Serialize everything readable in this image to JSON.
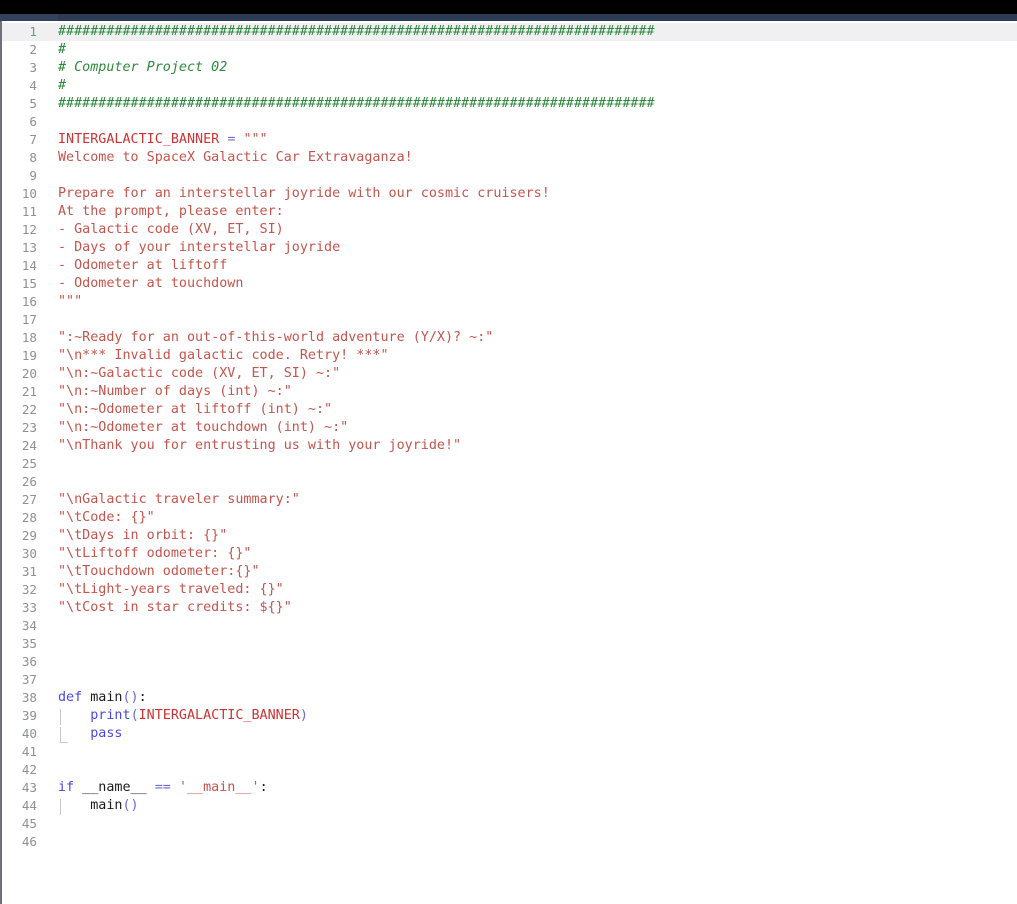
{
  "window": {
    "titlebar_color": "#000000",
    "tabstrip_color": "#2b3a55",
    "active_tab_color": "#33415c"
  },
  "editor": {
    "language": "python",
    "active_line": 1,
    "background": "#ffffff",
    "active_line_background": "#f0f0f2",
    "gutter_color": "#8e9095",
    "active_gutter_color": "#6aa06a",
    "total_lines": 46,
    "colors": {
      "comment": "#2f8a3f",
      "string": "#c4554d",
      "identifier": "#cc3333",
      "keyword": "#4a4ae0",
      "operator": "#6a6ad6",
      "plain": "#1b1b1b"
    },
    "lines": [
      {
        "n": 1,
        "text": "##########################################################################"
      },
      {
        "n": 2,
        "text": "#"
      },
      {
        "n": 3,
        "text": "# Computer Project 02"
      },
      {
        "n": 4,
        "text": "#"
      },
      {
        "n": 5,
        "text": "##########################################################################"
      },
      {
        "n": 6,
        "text": ""
      },
      {
        "n": 7,
        "text": "INTERGALACTIC_BANNER = \"\"\""
      },
      {
        "n": 8,
        "text": "Welcome to SpaceX Galactic Car Extravaganza!"
      },
      {
        "n": 9,
        "text": ""
      },
      {
        "n": 10,
        "text": "Prepare for an interstellar joyride with our cosmic cruisers!"
      },
      {
        "n": 11,
        "text": "At the prompt, please enter:"
      },
      {
        "n": 12,
        "text": "- Galactic code (XV, ET, SI)"
      },
      {
        "n": 13,
        "text": "- Days of your interstellar joyride"
      },
      {
        "n": 14,
        "text": "- Odometer at liftoff"
      },
      {
        "n": 15,
        "text": "- Odometer at touchdown"
      },
      {
        "n": 16,
        "text": "\"\"\""
      },
      {
        "n": 17,
        "text": ""
      },
      {
        "n": 18,
        "text": "\":~Ready for an out-of-this-world adventure (Y/X)? ~:\""
      },
      {
        "n": 19,
        "text": "\"\\n*** Invalid galactic code. Retry! ***\""
      },
      {
        "n": 20,
        "text": "\"\\n:~Galactic code (XV, ET, SI) ~:\""
      },
      {
        "n": 21,
        "text": "\"\\n:~Number of days (int) ~:\""
      },
      {
        "n": 22,
        "text": "\"\\n:~Odometer at liftoff (int) ~:\""
      },
      {
        "n": 23,
        "text": "\"\\n:~Odometer at touchdown (int) ~:\""
      },
      {
        "n": 24,
        "text": "\"\\nThank you for entrusting us with your joyride!\""
      },
      {
        "n": 25,
        "text": ""
      },
      {
        "n": 26,
        "text": ""
      },
      {
        "n": 27,
        "text": "\"\\nGalactic traveler summary:\""
      },
      {
        "n": 28,
        "text": "\"\\tCode: {}\""
      },
      {
        "n": 29,
        "text": "\"\\tDays in orbit: {}\""
      },
      {
        "n": 30,
        "text": "\"\\tLiftoff odometer: {}\""
      },
      {
        "n": 31,
        "text": "\"\\tTouchdown odometer:{}\""
      },
      {
        "n": 32,
        "text": "\"\\tLight-years traveled: {}\""
      },
      {
        "n": 33,
        "text": "\"\\tCost in star credits: ${}\""
      },
      {
        "n": 34,
        "text": ""
      },
      {
        "n": 35,
        "text": ""
      },
      {
        "n": 36,
        "text": ""
      },
      {
        "n": 37,
        "text": ""
      },
      {
        "n": 38,
        "text": "def main():"
      },
      {
        "n": 39,
        "text": "    print(INTERGALACTIC_BANNER)"
      },
      {
        "n": 40,
        "text": "    pass"
      },
      {
        "n": 41,
        "text": ""
      },
      {
        "n": 42,
        "text": ""
      },
      {
        "n": 43,
        "text": "if __name__ == '__main__':"
      },
      {
        "n": 44,
        "text": "    main()"
      },
      {
        "n": 45,
        "text": ""
      },
      {
        "n": 46,
        "text": ""
      }
    ],
    "tokens": {
      "1": [
        [
          "comment",
          "##########################################################################"
        ]
      ],
      "2": [
        [
          "comment",
          "#"
        ]
      ],
      "3": [
        [
          "comment",
          "# Computer Project 02"
        ]
      ],
      "4": [
        [
          "comment",
          "#"
        ]
      ],
      "5": [
        [
          "comment",
          "##########################################################################"
        ]
      ],
      "7": [
        [
          "identifier",
          "INTERGALACTIC_BANNER"
        ],
        [
          "plain",
          " "
        ],
        [
          "operator",
          "="
        ],
        [
          "plain",
          " "
        ],
        [
          "string",
          "\"\"\""
        ]
      ],
      "8": [
        [
          "string",
          "Welcome to SpaceX Galactic Car Extravaganza!"
        ]
      ],
      "10": [
        [
          "string",
          "Prepare for an interstellar joyride with our cosmic cruisers!"
        ]
      ],
      "11": [
        [
          "string",
          "At the prompt, please enter:"
        ]
      ],
      "12": [
        [
          "string",
          "- Galactic code (XV, ET, SI)"
        ]
      ],
      "13": [
        [
          "string",
          "- Days of your interstellar joyride"
        ]
      ],
      "14": [
        [
          "string",
          "- Odometer at liftoff"
        ]
      ],
      "15": [
        [
          "string",
          "- Odometer at touchdown"
        ]
      ],
      "16": [
        [
          "string",
          "\"\"\""
        ]
      ],
      "18": [
        [
          "string",
          "\":~Ready for an out-of-this-world adventure (Y/X)? ~:\""
        ]
      ],
      "19": [
        [
          "string",
          "\"\\n*** Invalid galactic code. Retry! ***\""
        ]
      ],
      "20": [
        [
          "string",
          "\"\\n:~Galactic code (XV, ET, SI) ~:\""
        ]
      ],
      "21": [
        [
          "string",
          "\"\\n:~Number of days (int) ~:\""
        ]
      ],
      "22": [
        [
          "string",
          "\"\\n:~Odometer at liftoff (int) ~:\""
        ]
      ],
      "23": [
        [
          "string",
          "\"\\n:~Odometer at touchdown (int) ~:\""
        ]
      ],
      "24": [
        [
          "string",
          "\"\\nThank you for entrusting us with your joyride!\""
        ]
      ],
      "27": [
        [
          "string",
          "\"\\nGalactic traveler summary:\""
        ]
      ],
      "28": [
        [
          "string",
          "\"\\tCode: {}\""
        ]
      ],
      "29": [
        [
          "string",
          "\"\\tDays in orbit: {}\""
        ]
      ],
      "30": [
        [
          "string",
          "\"\\tLiftoff odometer: {}\""
        ]
      ],
      "31": [
        [
          "string",
          "\"\\tTouchdown odometer:{}\""
        ]
      ],
      "32": [
        [
          "string",
          "\"\\tLight-years traveled: {}\""
        ]
      ],
      "33": [
        [
          "string",
          "\"\\tCost in star credits: ${}\""
        ]
      ],
      "38": [
        [
          "keyword",
          "def"
        ],
        [
          "plain",
          " "
        ],
        [
          "plain",
          "main"
        ],
        [
          "operator",
          "()"
        ],
        [
          "plain",
          ":"
        ]
      ],
      "39": [
        [
          "plain",
          "    "
        ],
        [
          "fn",
          "print"
        ],
        [
          "operator",
          "("
        ],
        [
          "identifier",
          "INTERGALACTIC_BANNER"
        ],
        [
          "operator",
          ")"
        ]
      ],
      "40": [
        [
          "plain",
          "    "
        ],
        [
          "keyword",
          "pass"
        ]
      ],
      "43": [
        [
          "keyword",
          "if"
        ],
        [
          "plain",
          " __name__ "
        ],
        [
          "operator",
          "=="
        ],
        [
          "plain",
          " "
        ],
        [
          "string",
          "'__main__'"
        ],
        [
          "plain",
          ":"
        ]
      ],
      "44": [
        [
          "plain",
          "    "
        ],
        [
          "plain",
          "main"
        ],
        [
          "operator",
          "()"
        ]
      ]
    },
    "indent_guides": [
      {
        "line": 39,
        "tick": false
      },
      {
        "line": 40,
        "tick": true
      },
      {
        "line": 44,
        "tick": false
      }
    ]
  }
}
